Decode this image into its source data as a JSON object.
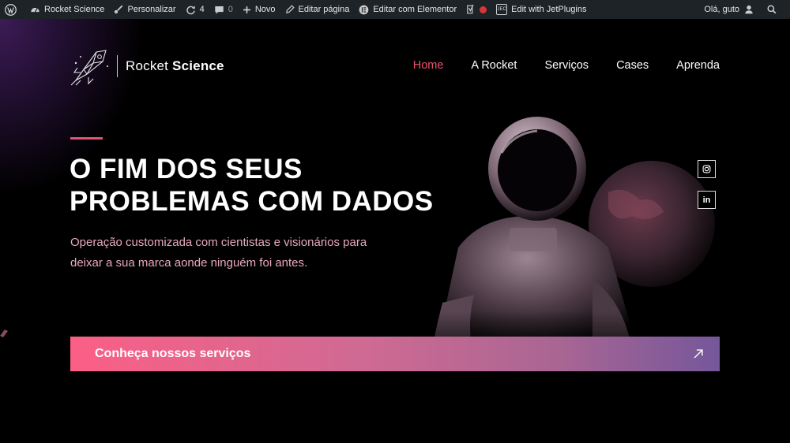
{
  "adminbar": {
    "site_name": "Rocket Science",
    "customize": "Personalizar",
    "updates_count": "4",
    "comments_count": "0",
    "new": "Novo",
    "edit_page": "Editar página",
    "edit_elementor": "Editar com Elementor",
    "jet": "Edit with JetPlugins",
    "jet_badge": "JEC",
    "greeting": "Olá, guto"
  },
  "logo": {
    "name_light": "Rocket ",
    "name_bold": "Science"
  },
  "nav": [
    {
      "label": "Home",
      "active": true
    },
    {
      "label": "A Rocket"
    },
    {
      "label": "Serviços"
    },
    {
      "label": "Cases"
    },
    {
      "label": "Aprenda"
    }
  ],
  "hero": {
    "headline_line1": "O FIM DOS SEUS",
    "headline_line2": "PROBLEMAS COM DADOS",
    "subtext": "Operação customizada com cientistas e visionários para deixar a sua marca aonde ninguém foi antes.",
    "cta": "Conheça nossos serviços"
  },
  "social": {
    "linkedin": "in"
  },
  "colors": {
    "accent": "#e8546e",
    "adminbar": "#1d2327",
    "cta_start": "#fb5f86",
    "cta_end": "#75579a"
  }
}
